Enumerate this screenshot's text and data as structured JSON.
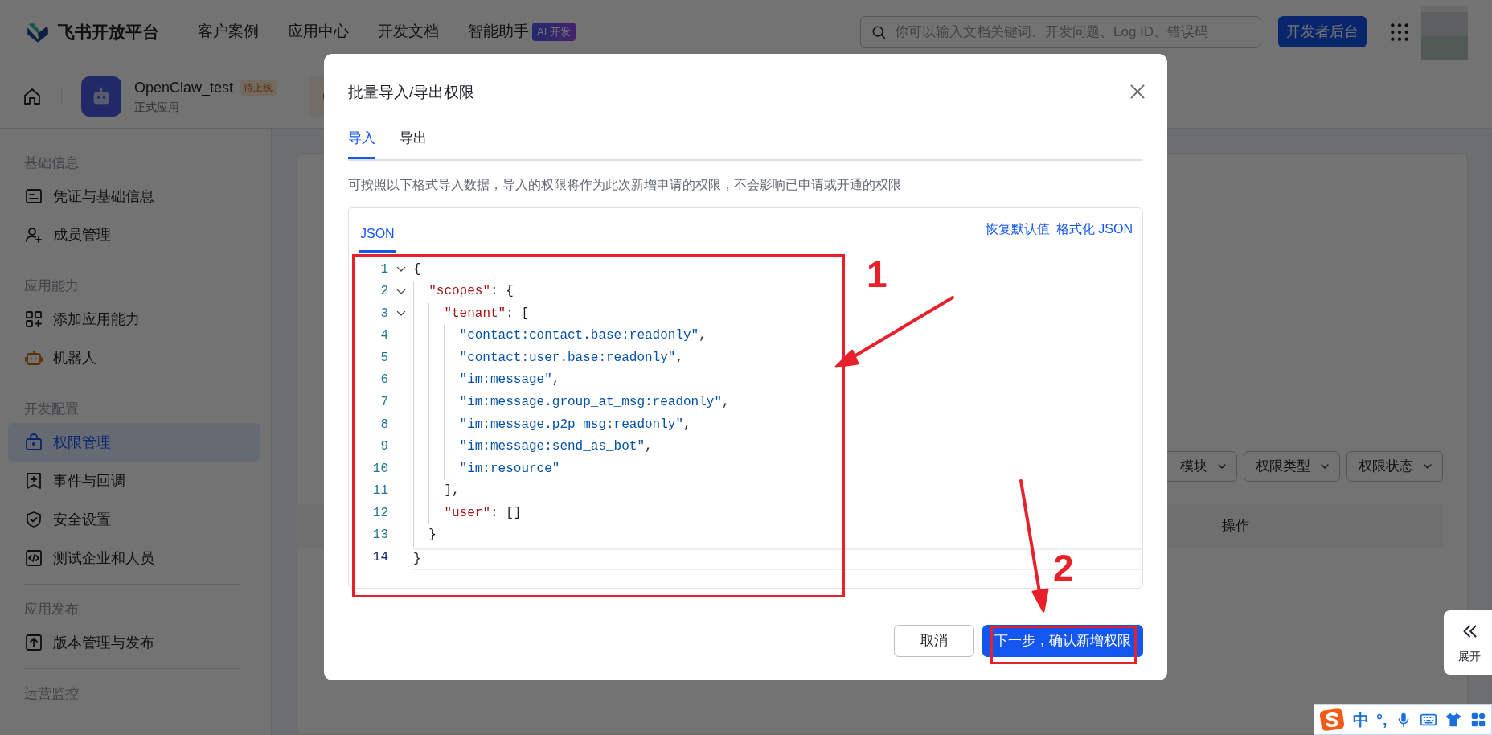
{
  "topbar": {
    "logo_text": "飞书开放平台",
    "nav": [
      {
        "label": "客户案例"
      },
      {
        "label": "应用中心"
      },
      {
        "label": "开发文档"
      },
      {
        "label": "智能助手",
        "badge": "AI 开发"
      }
    ],
    "search": {
      "placeholder": "你可以输入文档关键词、开发问题、Log ID、错误码"
    },
    "console_button": "开发者后台"
  },
  "app_bar": {
    "name": "OpenClaw_test",
    "status": "待上线",
    "type": "正式应用"
  },
  "sidebar": {
    "sections": [
      {
        "title": "基础信息",
        "items": [
          {
            "label": "凭证与基础信息",
            "selected": false
          },
          {
            "label": "成员管理",
            "selected": false
          }
        ]
      },
      {
        "title": "应用能力",
        "items": [
          {
            "label": "添加应用能力",
            "selected": false
          },
          {
            "label": "机器人",
            "selected": false
          }
        ]
      },
      {
        "title": "开发配置",
        "items": [
          {
            "label": "权限管理",
            "selected": true
          },
          {
            "label": "事件与回调",
            "selected": false
          },
          {
            "label": "安全设置",
            "selected": false
          },
          {
            "label": "测试企业和人员",
            "selected": false
          }
        ]
      },
      {
        "title": "应用发布",
        "items": [
          {
            "label": "版本管理与发布",
            "selected": false
          }
        ]
      },
      {
        "title": "运营监控"
      }
    ]
  },
  "filters": [
    {
      "label": "模块"
    },
    {
      "label": "权限类型"
    },
    {
      "label": "权限状态"
    }
  ],
  "table": {
    "columns": [
      {
        "label": "操作"
      }
    ]
  },
  "expand_button": "展开",
  "ime_toolbar": {
    "mode": "中",
    "punctuation": "°,"
  },
  "modal": {
    "title": "批量导入/导出权限",
    "tabs": [
      {
        "label": "导入",
        "selected": true
      },
      {
        "label": "导出",
        "selected": false
      }
    ],
    "description": "可按照以下格式导入数据，导入的权限将作为此次新增申请的权限，不会影响已申请或开通的权限",
    "editor": {
      "tab": "JSON",
      "actions": [
        "恢复默认值",
        "格式化 JSON"
      ],
      "lines": [
        {
          "number": "1",
          "text": "{",
          "foldable": true,
          "active": false
        },
        {
          "number": "2",
          "text": "  \"scopes\": {",
          "foldable": true,
          "active": false
        },
        {
          "number": "3",
          "text": "    \"tenant\": [",
          "foldable": true,
          "active": false
        },
        {
          "number": "4",
          "text": "      \"contact:contact.base:readonly\",",
          "foldable": false,
          "active": false
        },
        {
          "number": "5",
          "text": "      \"contact:user.base:readonly\",",
          "foldable": false,
          "active": false
        },
        {
          "number": "6",
          "text": "      \"im:message\",",
          "foldable": false,
          "active": false
        },
        {
          "number": "7",
          "text": "      \"im:message.group_at_msg:readonly\",",
          "foldable": false,
          "active": false
        },
        {
          "number": "8",
          "text": "      \"im:message.p2p_msg:readonly\",",
          "foldable": false,
          "active": false
        },
        {
          "number": "9",
          "text": "      \"im:message:send_as_bot\",",
          "foldable": false,
          "active": false
        },
        {
          "number": "10",
          "text": "      \"im:resource\"",
          "foldable": false,
          "active": false
        },
        {
          "number": "11",
          "text": "    ],",
          "foldable": false,
          "active": false
        },
        {
          "number": "12",
          "text": "    \"user\": []",
          "foldable": false,
          "active": false
        },
        {
          "number": "13",
          "text": "  }",
          "foldable": false,
          "active": false
        },
        {
          "number": "14",
          "text": "}",
          "foldable": false,
          "active": true
        }
      ]
    },
    "buttons": [
      {
        "label": "取消",
        "kind": "secondary"
      },
      {
        "label": "下一步，确认新增权限",
        "kind": "primary"
      }
    ]
  },
  "annotations": [
    {
      "number": "1"
    },
    {
      "number": "2"
    }
  ]
}
